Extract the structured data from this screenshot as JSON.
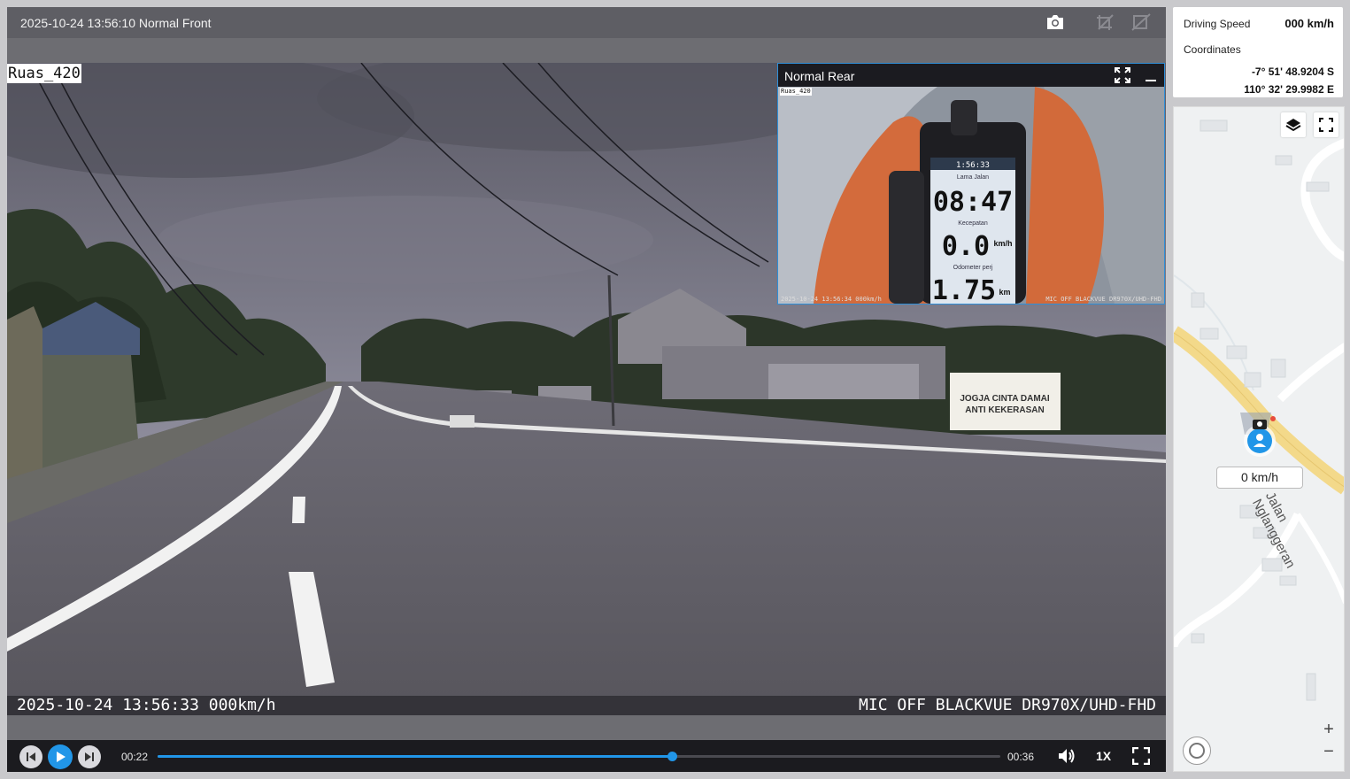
{
  "player": {
    "title": "2025-10-24 13:56:10 Normal Front",
    "front_overlay_label": "Ruas_420",
    "osd_left": "2025-10-24 13:56:33 000km/h",
    "osd_right": "MIC OFF BLACKVUE DR970X/UHD-FHD",
    "rear": {
      "title": "Normal Rear",
      "overlay_label": "Ruas_420",
      "osd_left": "2025-10-24 13:56:34 000km/h",
      "osd_right": "MIC OFF BLACKVUE DR970X/UHD-FHD",
      "device": {
        "clock": "1:56:33",
        "time_label": "Lama Jalan",
        "time_value": "08:47",
        "speed_label": "Kecepatan",
        "speed_value": "0.0",
        "speed_unit": "km/h",
        "distance_label": "Odometer perj",
        "distance_value": "1.75",
        "distance_unit": "km"
      }
    },
    "controls": {
      "current_time": "00:22",
      "total_time": "00:36",
      "progress": 0.61,
      "playback_rate": "1X"
    },
    "banner_text": [
      "JOGJA CINTA DAMAI",
      "ANTI KEKERASAN"
    ],
    "icons": [
      "camera-icon",
      "crop-icon",
      "crop-off-icon",
      "prev-icon",
      "play-icon",
      "next-icon",
      "volume-icon",
      "fullscreen-icon",
      "expand-icon",
      "minimize-icon"
    ]
  },
  "info": {
    "speed_label": "Driving Speed",
    "speed_value": "000 km/h",
    "coordinates_label": "Coordinates",
    "lat": "-7° 51' 48.9204 S",
    "lon": "110° 32' 29.9982 E"
  },
  "map": {
    "speed_tag": "0 km/h",
    "road_label": "Jalan Nglanggeran",
    "zoom_in": "+",
    "zoom_out": "−",
    "accent": "#2196e8",
    "road_color": "#f3d98a"
  }
}
